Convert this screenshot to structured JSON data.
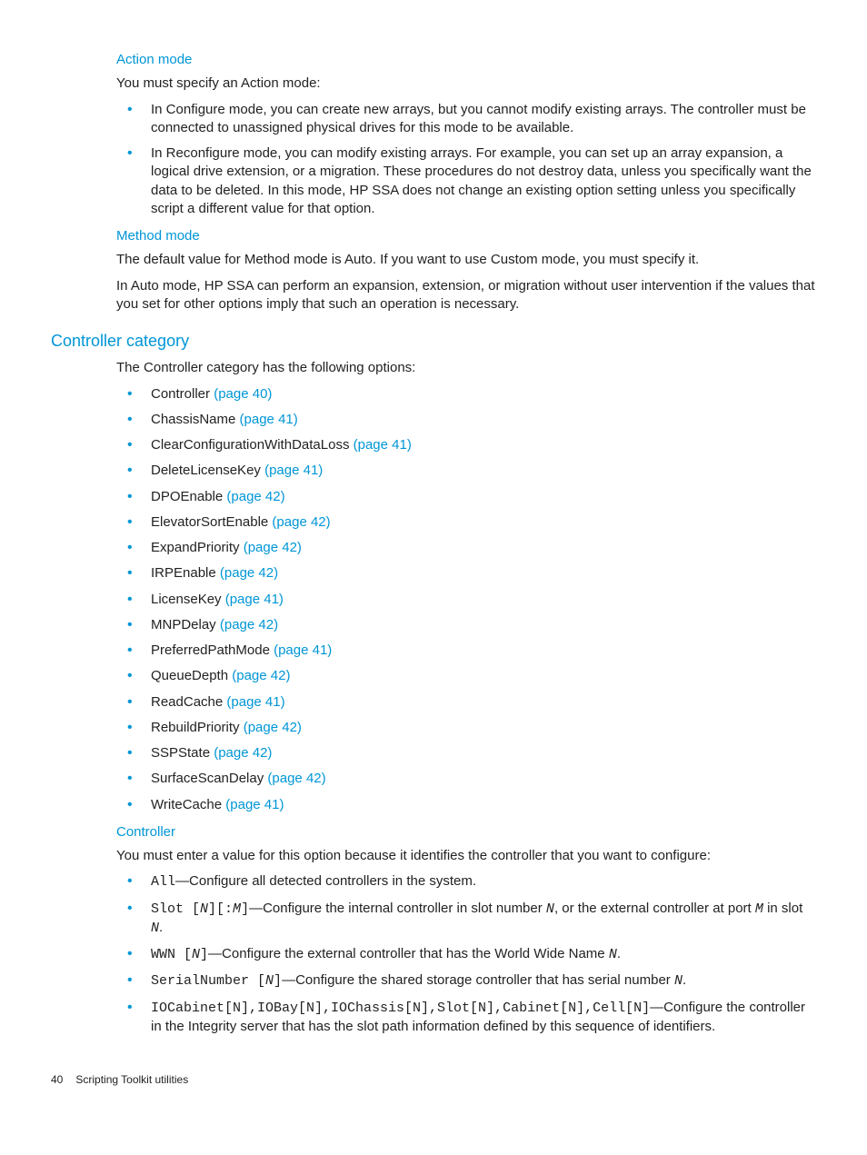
{
  "sections": {
    "action_mode": {
      "heading": "Action mode",
      "intro": "You must specify an Action mode:",
      "bullets": [
        "In Configure mode, you can create new arrays, but you cannot modify existing arrays. The controller must be connected to unassigned physical drives for this mode to be available.",
        "In Reconfigure mode, you can modify existing arrays. For example, you can set up an array expansion, a logical drive extension, or a migration. These procedures do not destroy data, unless you specifically want the data to be deleted. In this mode, HP SSA does not change an existing option setting unless you specifically script a different value for that option."
      ]
    },
    "method_mode": {
      "heading": "Method mode",
      "p1": "The default value for Method mode is Auto. If you want to use Custom mode, you must specify it.",
      "p2": "In Auto mode, HP SSA can perform an expansion, extension, or migration without user intervention if the values that you set for other options imply that such an operation is necessary."
    },
    "controller_category": {
      "heading": "Controller category",
      "intro": "The Controller category has the following options:",
      "options": [
        {
          "name": "Controller",
          "page": "(page 40)"
        },
        {
          "name": "ChassisName",
          "page": "(page 41)"
        },
        {
          "name": "ClearConfigurationWithDataLoss",
          "page": "(page 41)"
        },
        {
          "name": "DeleteLicenseKey",
          "page": "(page 41)"
        },
        {
          "name": "DPOEnable",
          "page": "(page 42)"
        },
        {
          "name": "ElevatorSortEnable",
          "page": "(page 42)"
        },
        {
          "name": "ExpandPriority",
          "page": "(page 42)"
        },
        {
          "name": "IRPEnable",
          "page": "(page 42)"
        },
        {
          "name": "LicenseKey",
          "page": "(page 41)"
        },
        {
          "name": "MNPDelay",
          "page": "(page 42)"
        },
        {
          "name": "PreferredPathMode",
          "page": "(page 41)"
        },
        {
          "name": "QueueDepth",
          "page": "(page 42)"
        },
        {
          "name": "ReadCache",
          "page": "(page 41)"
        },
        {
          "name": "RebuildPriority",
          "page": "(page 42)"
        },
        {
          "name": "SSPState",
          "page": "(page 42)"
        },
        {
          "name": "SurfaceScanDelay",
          "page": "(page 42)"
        },
        {
          "name": "WriteCache",
          "page": "(page 41)"
        }
      ]
    },
    "controller": {
      "heading": "Controller",
      "intro": "You must enter a value for this option because it identifies the controller that you want to configure:",
      "items": {
        "all_code": "All",
        "all_text": "—Configure all detected controllers in the system.",
        "slot_code1": "Slot [",
        "slot_n1": "N",
        "slot_code2": "][:",
        "slot_m": "M",
        "slot_code3": "]",
        "slot_text1": "—Configure the internal controller in slot number ",
        "slot_n2": "N",
        "slot_text2": ", or the external controller at port ",
        "slot_m2": "M",
        "slot_text3": " in slot ",
        "slot_n3": "N",
        "slot_text4": ".",
        "wwn_code1": "WWN [",
        "wwn_n": "N",
        "wwn_code2": "]",
        "wwn_text1": "—Configure the external controller that has the World Wide Name ",
        "wwn_n2": "N",
        "wwn_text2": ".",
        "sn_code1": "SerialNumber [",
        "sn_n": "N",
        "sn_code2": "]",
        "sn_text1": "—Configure the shared storage controller that has serial number ",
        "sn_n2": "N",
        "sn_text2": ".",
        "io_code": "IOCabinet[N],IOBay[N],IOChassis[N],Slot[N],Cabinet[N],Cell[N]",
        "io_text": "—Configure the controller in the Integrity server that has the slot path information defined by this sequence of identifiers."
      }
    }
  },
  "footer": {
    "page": "40",
    "title": "Scripting Toolkit utilities"
  }
}
